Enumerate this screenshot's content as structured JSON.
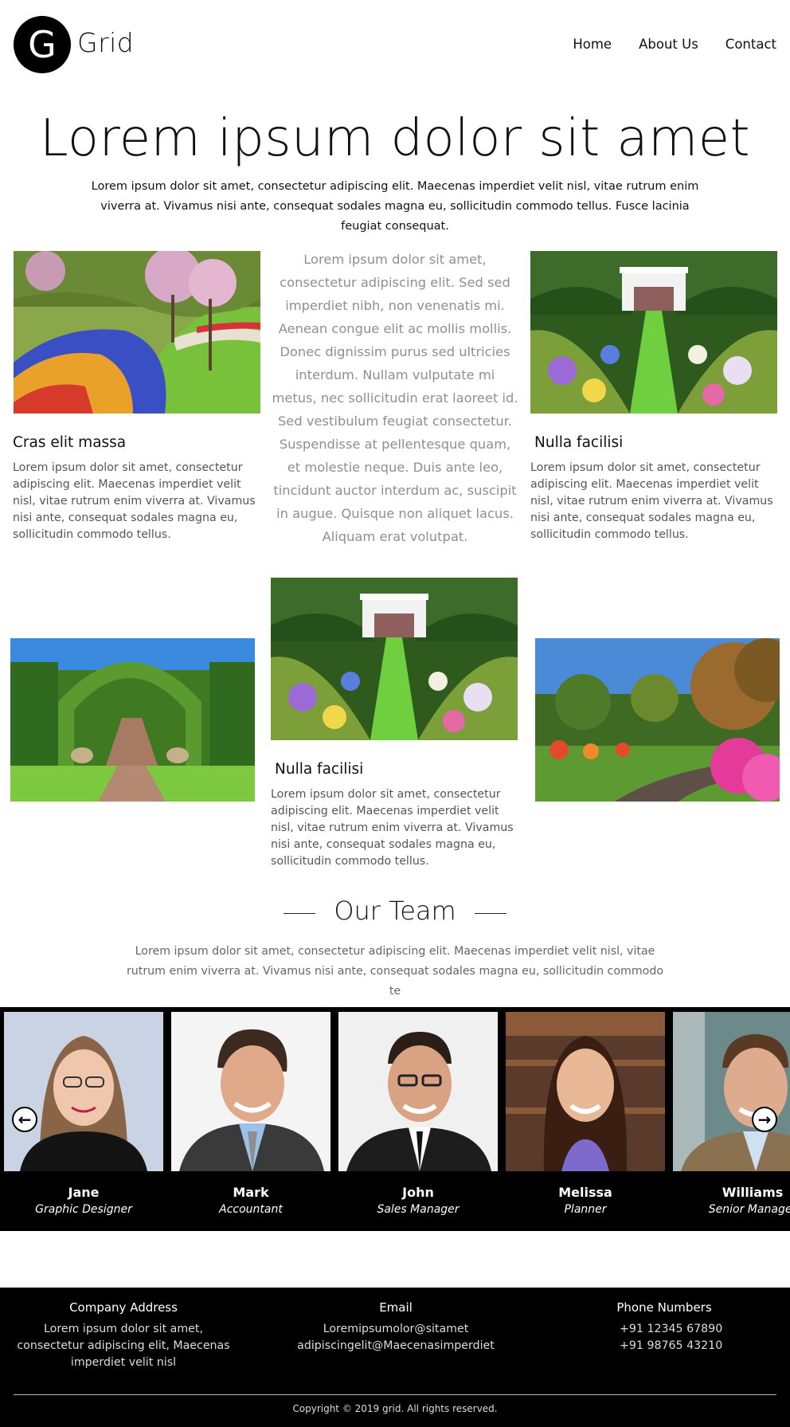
{
  "header": {
    "logo_letter": "G",
    "brand": "Grid",
    "nav": [
      "Home",
      "About Us",
      "Contact"
    ]
  },
  "hero": {
    "title": "Lorem ipsum dolor sit amet",
    "subtitle": "Lorem ipsum dolor sit amet, consectetur adipiscing elit. Maecenas imperdiet velit nisl, vitae rutrum enim viverra at. Vivamus nisi ante, consequat sodales magna eu, sollicitudin commodo tellus. Fusce lacinia feugiat consequat."
  },
  "grid": {
    "center_text": "Lorem ipsum dolor sit amet, consectetur adipiscing elit. Sed sed imperdiet nibh, non venenatis mi. Aenean congue elit ac mollis mollis. Donec dignissim purus sed ultricies interdum. Nullam vulputate mi metus, nec sollicitudin erat laoreet id. Sed vestibulum feugiat consectetur. Suspendisse at pellentesque quam, et molestie neque. Duis ante leo, tincidunt auctor interdum ac, suscipit in augue. Quisque non aliquet lacus. Aliquam erat volutpat.",
    "cards": [
      {
        "title": "Cras elit massa",
        "text": "Lorem ipsum dolor sit amet, consectetur adipiscing elit. Maecenas imperdiet velit nisl, vitae rutrum enim viverra at. Vivamus nisi ante, consequat sodales magna eu, sollicitudin commodo tellus."
      },
      {
        "title": "Nulla facilisi",
        "text": "Lorem ipsum dolor sit amet, consectetur adipiscing elit. Maecenas imperdiet velit nisl, vitae rutrum enim viverra at. Vivamus nisi ante, consequat sodales magna eu, sollicitudin commodo tellus."
      },
      {
        "title": "Nulla facilisi",
        "text": "Lorem ipsum dolor sit amet, consectetur adipiscing elit. Maecenas imperdiet velit nisl, vitae rutrum enim viverra at. Vivamus nisi ante, consequat sodales magna eu, sollicitudin commodo tellus."
      }
    ]
  },
  "team": {
    "title": "Our Team",
    "subtitle": "Lorem ipsum dolor sit amet, consectetur adipiscing elit. Maecenas imperdiet velit nisl, vitae rutrum enim viverra at. Vivamus nisi ante, consequat sodales magna eu, sollicitudin commodo te",
    "members": [
      {
        "name": "Jane",
        "role": "Graphic Designer"
      },
      {
        "name": "Mark",
        "role": "Accountant"
      },
      {
        "name": "John",
        "role": "Sales Manager"
      },
      {
        "name": "Melissa",
        "role": "Planner"
      },
      {
        "name": "Williams",
        "role": "Senior Manager"
      }
    ],
    "prev_icon": "arrow-left-circle-icon",
    "next_icon": "arrow-right-circle-icon"
  },
  "footer": {
    "address_heading": "Company Address",
    "address_text": "Lorem ipsum dolor sit amet, consectetur adipiscing elit, Maecenas imperdiet velit nisl",
    "email_heading": "Email",
    "email_lines": [
      "Loremipsumolor@sitamet",
      "adipiscingelit@Maecenasimperdiet"
    ],
    "phone_heading": "Phone Numbers",
    "phone_lines": [
      "+91 12345 67890",
      "+91 98765 43210"
    ],
    "copyright": "Copyright © 2019 grid. All rights reserved."
  }
}
